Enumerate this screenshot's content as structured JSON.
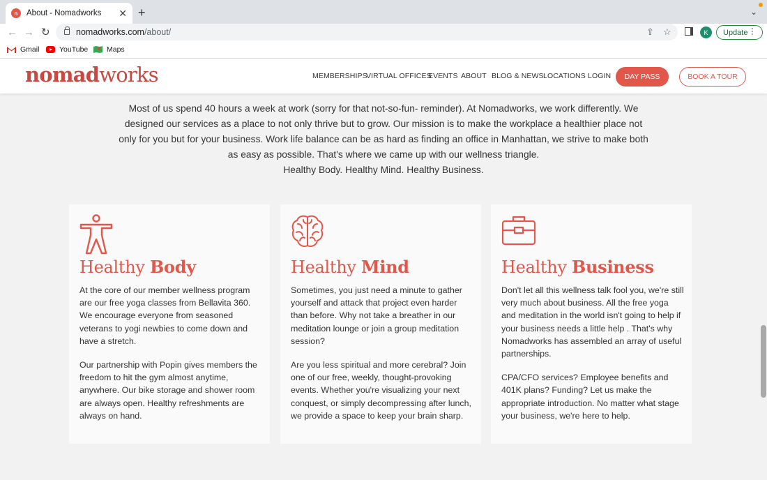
{
  "browser": {
    "tab_title": "About - Nomadworks",
    "favicon_text": "n",
    "url_host": "nomadworks.com",
    "url_path": "/about/",
    "profile_initial": "K",
    "update_label": "Update",
    "bookmarks": [
      "Gmail",
      "YouTube",
      "Maps"
    ]
  },
  "site": {
    "logo_bold": "nomad",
    "logo_light": "works",
    "nav": [
      "MEMBERSHIPS",
      "VIRTUAL OFFICES",
      "EVENTS",
      "ABOUT",
      "BLOG & NEWS",
      "LOCATIONS",
      "LOGIN"
    ],
    "day_pass": "DAY PASS",
    "book_tour": "BOOK A TOUR",
    "accent": "#e1574a"
  },
  "intro": {
    "lines": [
      "Most of us spend 40 hours a week at work (sorry for that not-so-fun- reminder). At Nomadworks, we work differently. We designed our services as a place to not only thrive but to grow. Our mission is to make the workplace a healthier place not only for you but for your business. Work life balance can be as hard as finding an office in Manhattan, we strive to make both as easy as possible. That's where we came up with our wellness triangle.",
      "Healthy Body. Healthy Mind. Healthy Business."
    ]
  },
  "cards": [
    {
      "icon": "person-icon",
      "title_light": "Healthy ",
      "title_bold": "Body",
      "paragraphs": [
        "At the core of our member wellness program are our free yoga classes from Bellavita 360. We encourage everyone from seasoned veterans to yogi newbies to come down and have a stretch.",
        "Our partnership with Popin gives members the freedom to hit the gym almost anytime, anywhere. Our bike storage and shower room are always open. Healthy refreshments are always on hand."
      ]
    },
    {
      "icon": "brain-icon",
      "title_light": "Healthy ",
      "title_bold": "Mind",
      "paragraphs": [
        "Sometimes, you just need a minute to gather yourself and attack that project even harder than before. Why not take a breather in our meditation lounge or join a group meditation session?",
        "Are you less spiritual and more cerebral? Join one of our free, weekly, thought-provoking events. Whether you're visualizing your next conquest, or simply decompressing after lunch, we provide a space to keep your brain sharp."
      ]
    },
    {
      "icon": "briefcase-icon",
      "title_light": "Healthy ",
      "title_bold": "Business",
      "paragraphs": [
        "Don't let all this wellness talk fool you, we're still very much about business. All the free yoga and meditation in the world isn't going to help if your business needs a little help . That's why Nomadworks has assembled an array of useful partnerships.",
        "CPA/CFO services? Employee benefits and 401K plans? Funding? Let us make the appropriate introduction. No matter what stage your business, we're here to help."
      ]
    }
  ]
}
